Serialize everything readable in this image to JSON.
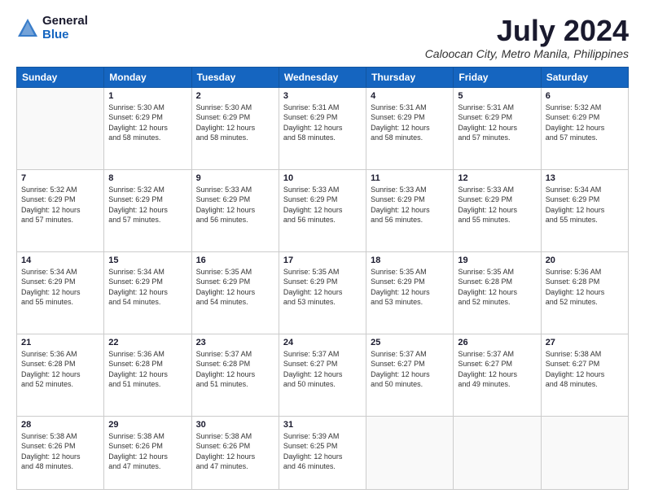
{
  "logo": {
    "general": "General",
    "blue": "Blue"
  },
  "title": "July 2024",
  "subtitle": "Caloocan City, Metro Manila, Philippines",
  "days_header": [
    "Sunday",
    "Monday",
    "Tuesday",
    "Wednesday",
    "Thursday",
    "Friday",
    "Saturday"
  ],
  "weeks": [
    [
      {
        "day": "",
        "info": ""
      },
      {
        "day": "1",
        "info": "Sunrise: 5:30 AM\nSunset: 6:29 PM\nDaylight: 12 hours\nand 58 minutes."
      },
      {
        "day": "2",
        "info": "Sunrise: 5:30 AM\nSunset: 6:29 PM\nDaylight: 12 hours\nand 58 minutes."
      },
      {
        "day": "3",
        "info": "Sunrise: 5:31 AM\nSunset: 6:29 PM\nDaylight: 12 hours\nand 58 minutes."
      },
      {
        "day": "4",
        "info": "Sunrise: 5:31 AM\nSunset: 6:29 PM\nDaylight: 12 hours\nand 58 minutes."
      },
      {
        "day": "5",
        "info": "Sunrise: 5:31 AM\nSunset: 6:29 PM\nDaylight: 12 hours\nand 57 minutes."
      },
      {
        "day": "6",
        "info": "Sunrise: 5:32 AM\nSunset: 6:29 PM\nDaylight: 12 hours\nand 57 minutes."
      }
    ],
    [
      {
        "day": "7",
        "info": "Sunrise: 5:32 AM\nSunset: 6:29 PM\nDaylight: 12 hours\nand 57 minutes."
      },
      {
        "day": "8",
        "info": "Sunrise: 5:32 AM\nSunset: 6:29 PM\nDaylight: 12 hours\nand 57 minutes."
      },
      {
        "day": "9",
        "info": "Sunrise: 5:33 AM\nSunset: 6:29 PM\nDaylight: 12 hours\nand 56 minutes."
      },
      {
        "day": "10",
        "info": "Sunrise: 5:33 AM\nSunset: 6:29 PM\nDaylight: 12 hours\nand 56 minutes."
      },
      {
        "day": "11",
        "info": "Sunrise: 5:33 AM\nSunset: 6:29 PM\nDaylight: 12 hours\nand 56 minutes."
      },
      {
        "day": "12",
        "info": "Sunrise: 5:33 AM\nSunset: 6:29 PM\nDaylight: 12 hours\nand 55 minutes."
      },
      {
        "day": "13",
        "info": "Sunrise: 5:34 AM\nSunset: 6:29 PM\nDaylight: 12 hours\nand 55 minutes."
      }
    ],
    [
      {
        "day": "14",
        "info": "Sunrise: 5:34 AM\nSunset: 6:29 PM\nDaylight: 12 hours\nand 55 minutes."
      },
      {
        "day": "15",
        "info": "Sunrise: 5:34 AM\nSunset: 6:29 PM\nDaylight: 12 hours\nand 54 minutes."
      },
      {
        "day": "16",
        "info": "Sunrise: 5:35 AM\nSunset: 6:29 PM\nDaylight: 12 hours\nand 54 minutes."
      },
      {
        "day": "17",
        "info": "Sunrise: 5:35 AM\nSunset: 6:29 PM\nDaylight: 12 hours\nand 53 minutes."
      },
      {
        "day": "18",
        "info": "Sunrise: 5:35 AM\nSunset: 6:29 PM\nDaylight: 12 hours\nand 53 minutes."
      },
      {
        "day": "19",
        "info": "Sunrise: 5:35 AM\nSunset: 6:28 PM\nDaylight: 12 hours\nand 52 minutes."
      },
      {
        "day": "20",
        "info": "Sunrise: 5:36 AM\nSunset: 6:28 PM\nDaylight: 12 hours\nand 52 minutes."
      }
    ],
    [
      {
        "day": "21",
        "info": "Sunrise: 5:36 AM\nSunset: 6:28 PM\nDaylight: 12 hours\nand 52 minutes."
      },
      {
        "day": "22",
        "info": "Sunrise: 5:36 AM\nSunset: 6:28 PM\nDaylight: 12 hours\nand 51 minutes."
      },
      {
        "day": "23",
        "info": "Sunrise: 5:37 AM\nSunset: 6:28 PM\nDaylight: 12 hours\nand 51 minutes."
      },
      {
        "day": "24",
        "info": "Sunrise: 5:37 AM\nSunset: 6:27 PM\nDaylight: 12 hours\nand 50 minutes."
      },
      {
        "day": "25",
        "info": "Sunrise: 5:37 AM\nSunset: 6:27 PM\nDaylight: 12 hours\nand 50 minutes."
      },
      {
        "day": "26",
        "info": "Sunrise: 5:37 AM\nSunset: 6:27 PM\nDaylight: 12 hours\nand 49 minutes."
      },
      {
        "day": "27",
        "info": "Sunrise: 5:38 AM\nSunset: 6:27 PM\nDaylight: 12 hours\nand 48 minutes."
      }
    ],
    [
      {
        "day": "28",
        "info": "Sunrise: 5:38 AM\nSunset: 6:26 PM\nDaylight: 12 hours\nand 48 minutes."
      },
      {
        "day": "29",
        "info": "Sunrise: 5:38 AM\nSunset: 6:26 PM\nDaylight: 12 hours\nand 47 minutes."
      },
      {
        "day": "30",
        "info": "Sunrise: 5:38 AM\nSunset: 6:26 PM\nDaylight: 12 hours\nand 47 minutes."
      },
      {
        "day": "31",
        "info": "Sunrise: 5:39 AM\nSunset: 6:25 PM\nDaylight: 12 hours\nand 46 minutes."
      },
      {
        "day": "",
        "info": ""
      },
      {
        "day": "",
        "info": ""
      },
      {
        "day": "",
        "info": ""
      }
    ]
  ]
}
